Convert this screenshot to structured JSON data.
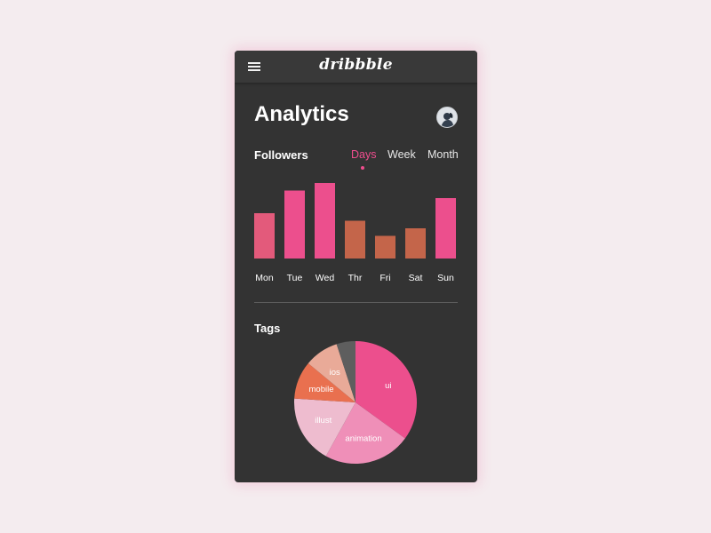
{
  "app": {
    "logo": "dribbble",
    "title": "Analytics"
  },
  "followers": {
    "label": "Followers",
    "tabs": [
      {
        "label": "Days",
        "active": true
      },
      {
        "label": "Week",
        "active": false
      },
      {
        "label": "Month",
        "active": false
      }
    ]
  },
  "tags": {
    "label": "Tags"
  },
  "colors": {
    "accent": "#ee4d8e",
    "background": "#333333",
    "bar_pink": "#ec4f8d",
    "bar_rust": "#c4654a"
  },
  "chart_data": [
    {
      "type": "bar",
      "categories": [
        "Mon",
        "Tue",
        "Wed",
        "Thr",
        "Fri",
        "Sat",
        "Sun"
      ],
      "values": [
        6,
        9,
        10,
        5,
        3,
        4,
        8
      ],
      "colors": [
        "#e35a7b",
        "#ec4f8d",
        "#ec4f8d",
        "#c4654a",
        "#c4654a",
        "#c4654a",
        "#ec4f8d"
      ],
      "ylim": [
        0,
        10
      ],
      "grid": false
    },
    {
      "type": "pie",
      "labels": [
        "ui",
        "animation",
        "illust",
        "mobile",
        "ios",
        ""
      ],
      "values": [
        35,
        23,
        18,
        10,
        9,
        5
      ],
      "colors": [
        "#ec4f8d",
        "#ef8fb8",
        "#eebccf",
        "#e9704f",
        "#e9aa98",
        "#5e5e5e"
      ]
    }
  ]
}
